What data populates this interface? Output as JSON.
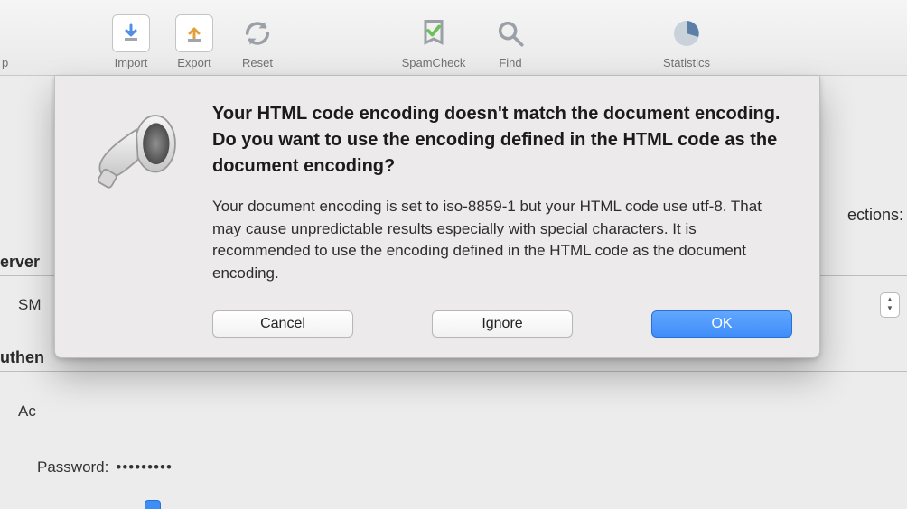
{
  "toolbar": {
    "items": [
      {
        "label": "p"
      },
      {
        "label": "Import"
      },
      {
        "label": "Export"
      },
      {
        "label": "Reset"
      },
      {
        "label": "SpamCheck"
      },
      {
        "label": "Find"
      },
      {
        "label": "Statistics"
      }
    ]
  },
  "background": {
    "section_server_partial": "erver",
    "row_sm_partial": "SM",
    "section_authen_partial": "uthen",
    "row_account_partial": "Ac",
    "connections_partial": "ections:",
    "password_label": "Password:",
    "password_dots": "•••••••••"
  },
  "dialog": {
    "heading": "Your HTML code encoding doesn't match the document encoding. Do you want to use the encoding defined in the HTML code as the document encoding?",
    "message": "Your document encoding is set to iso-8859-1 but your HTML code use utf-8. That may cause unpredictable results especially with special characters. It is recommended to use the encoding defined in the HTML code as the document encoding.",
    "buttons": {
      "cancel": "Cancel",
      "ignore": "Ignore",
      "ok": "OK"
    }
  }
}
